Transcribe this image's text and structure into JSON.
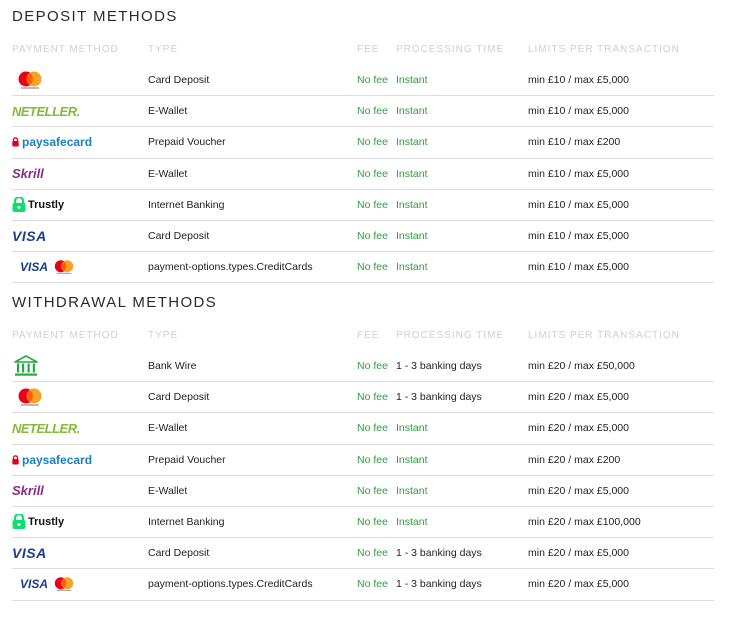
{
  "deposit": {
    "title": "DEPOSIT METHODS",
    "headers": {
      "method": "PAYMENT METHOD",
      "type": "TYPE",
      "fee": "FEE",
      "processing": "PROCESSING TIME",
      "limits": "LIMITS PER TRANSACTION"
    },
    "rows": [
      {
        "logo": "mastercard-icon",
        "type": "Card Deposit",
        "fee": "No fee",
        "processing": "Instant",
        "limits": "min £10 / max £5,000"
      },
      {
        "logo": "neteller-icon",
        "logo_text": "NETELLER.",
        "type": "E-Wallet",
        "fee": "No fee",
        "processing": "Instant",
        "limits": "min £10 / max £5,000"
      },
      {
        "logo": "paysafecard-icon",
        "logo_text": "paysafecard",
        "type": "Prepaid Voucher",
        "fee": "No fee",
        "processing": "Instant",
        "limits": "min £10 / max £200"
      },
      {
        "logo": "skrill-icon",
        "logo_text": "Skrill",
        "type": "E-Wallet",
        "fee": "No fee",
        "processing": "Instant",
        "limits": "min £10 / max £5,000"
      },
      {
        "logo": "trustly-icon",
        "logo_text": "Trustly",
        "type": "Internet Banking",
        "fee": "No fee",
        "processing": "Instant",
        "limits": "min £10 / max £5,000"
      },
      {
        "logo": "visa-icon",
        "logo_text": "VISA",
        "type": "Card Deposit",
        "fee": "No fee",
        "processing": "Instant",
        "limits": "min £10 / max £5,000"
      },
      {
        "logo": "visa-mastercard-icon",
        "logo_text": "VISA",
        "type": "payment-options.types.CreditCards",
        "fee": "No fee",
        "processing": "Instant",
        "limits": "min £10 / max £5,000"
      }
    ]
  },
  "withdrawal": {
    "title": "WITHDRAWAL METHODS",
    "headers": {
      "method": "PAYMENT METHOD",
      "type": "TYPE",
      "fee": "FEE",
      "processing": "PROCESSING TIME",
      "limits": "LIMITS PER TRANSACTION"
    },
    "rows": [
      {
        "logo": "bank-icon",
        "type": "Bank Wire",
        "fee": "No fee",
        "processing": "1 - 3 banking days",
        "limits": "min £20 / max £50,000"
      },
      {
        "logo": "mastercard-icon",
        "type": "Card Deposit",
        "fee": "No fee",
        "processing": "1 - 3 banking days",
        "limits": "min £20 / max £5,000"
      },
      {
        "logo": "neteller-icon",
        "logo_text": "NETELLER.",
        "type": "E-Wallet",
        "fee": "No fee",
        "processing": "Instant",
        "limits": "min £20 / max £5,000"
      },
      {
        "logo": "paysafecard-icon",
        "logo_text": "paysafecard",
        "type": "Prepaid Voucher",
        "fee": "No fee",
        "processing": "Instant",
        "limits": "min £20 / max £200"
      },
      {
        "logo": "skrill-icon",
        "logo_text": "Skrill",
        "type": "E-Wallet",
        "fee": "No fee",
        "processing": "Instant",
        "limits": "min £20 / max £5,000"
      },
      {
        "logo": "trustly-icon",
        "logo_text": "Trustly",
        "type": "Internet Banking",
        "fee": "No fee",
        "processing": "Instant",
        "limits": "min £20 / max £100,000"
      },
      {
        "logo": "visa-icon",
        "logo_text": "VISA",
        "type": "Card Deposit",
        "fee": "No fee",
        "processing": "1 - 3 banking days",
        "limits": "min £20 / max £5,000"
      },
      {
        "logo": "visa-mastercard-icon",
        "logo_text": "VISA",
        "type": "payment-options.types.CreditCards",
        "fee": "No fee",
        "processing": "1 - 3 banking days",
        "limits": "min £20 / max £5,000"
      }
    ]
  },
  "colors": {
    "green": "#2e9e3a",
    "header_grey": "#cfcfcf",
    "divider": "#dcdcdc"
  }
}
